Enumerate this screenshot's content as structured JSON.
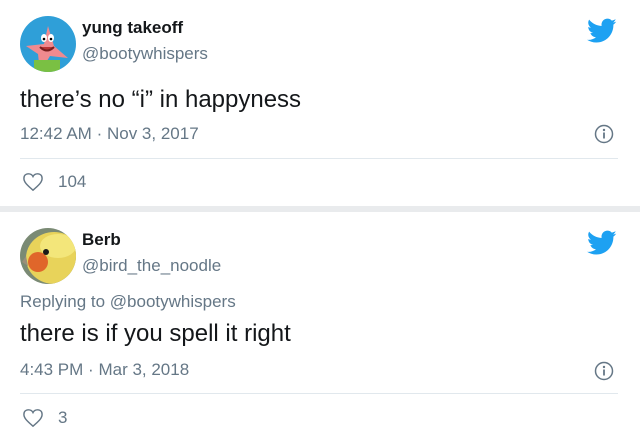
{
  "tweets": [
    {
      "display_name": "yung takeoff",
      "handle": "@bootywhispers",
      "text": "there’s no “i” in happyness",
      "time": "12:42 AM",
      "date": "Nov 3, 2017",
      "separator": "·",
      "likes": "104",
      "avatar_icon": "patrick-star-avatar",
      "brand_icon": "twitter-bird-icon",
      "like_icon": "heart-icon",
      "info_icon": "info-icon"
    },
    {
      "display_name": "Berb",
      "handle": "@bird_the_noodle",
      "replying_prefix": "Replying to",
      "replying_to": "@bootywhispers",
      "text": "there is if you spell it right",
      "time": "4:43 PM",
      "date": "Mar 3, 2018",
      "separator": "·",
      "likes": "3",
      "avatar_icon": "cockatiel-avatar",
      "brand_icon": "twitter-bird-icon",
      "like_icon": "heart-icon",
      "info_icon": "info-icon"
    }
  ],
  "colors": {
    "twitter_blue": "#1da1f2",
    "text_primary": "#14171a",
    "text_secondary": "#657786",
    "divider": "#e1e8ed",
    "page_background": "#e9ebed"
  }
}
